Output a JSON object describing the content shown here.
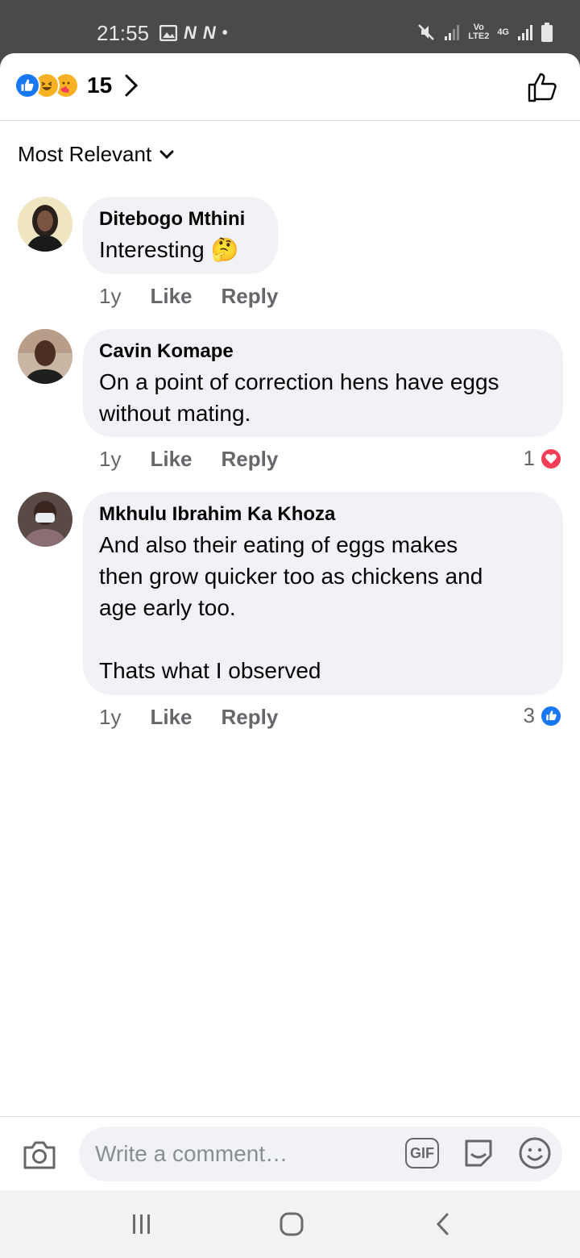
{
  "status_bar": {
    "time": "21:55",
    "left_icons": [
      "image-icon",
      "n-icon",
      "n-icon",
      "dot-icon"
    ],
    "right_icons": [
      "mute-icon",
      "signal-icon",
      "volte-icon",
      "4g-icon",
      "signal-icon",
      "battery-icon"
    ],
    "volte_label": "Vo\nLTE2",
    "network_label": "4G"
  },
  "header": {
    "reaction_icons": [
      "like-reaction-icon",
      "haha-reaction-icon",
      "care-reaction-icon"
    ],
    "reaction_count": "15"
  },
  "sort": {
    "label": "Most Relevant"
  },
  "comments": [
    {
      "author": "Ditebogo Mthini",
      "text": "Interesting 🤔",
      "age": "1y",
      "like_label": "Like",
      "reply_label": "Reply",
      "reaction_count": "",
      "reaction_type": ""
    },
    {
      "author": "Cavin Komape",
      "text": "On a point of correction hens have eggs\nwithout mating.",
      "age": "1y",
      "like_label": "Like",
      "reply_label": "Reply",
      "reaction_count": "1",
      "reaction_type": "love"
    },
    {
      "author": "Mkhulu Ibrahim Ka Khoza",
      "text": "And also their eating of eggs makes\nthen grow quicker too as chickens and\nage early too.\n\nThats what I observed",
      "age": "1y",
      "like_label": "Like",
      "reply_label": "Reply",
      "reaction_count": "3",
      "reaction_type": "like"
    }
  ],
  "composer": {
    "placeholder": "Write a comment…",
    "gif_label": "GIF"
  },
  "colors": {
    "accent": "#1877f2",
    "love": "#f33e58",
    "bubble": "#f0f2f5",
    "secondary_text": "#65676b"
  }
}
